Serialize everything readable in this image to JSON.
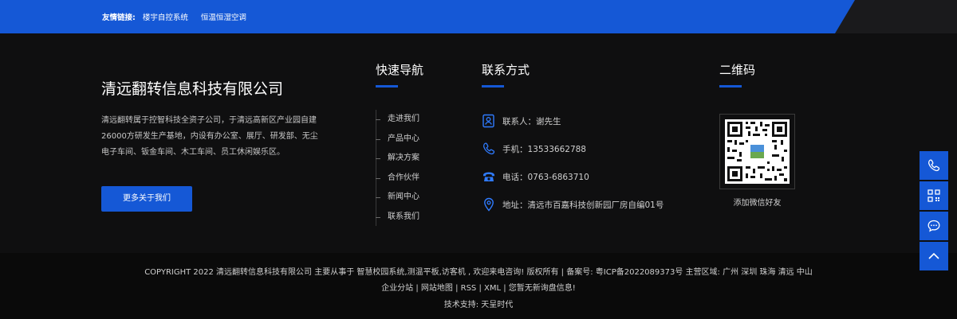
{
  "friend_links": {
    "title": "友情链接:",
    "links": [
      "楼宇自控系统",
      "恒温恒湿空调"
    ]
  },
  "company": {
    "name": "清远翻转信息科技有限公司",
    "description": "清远翻转属于控智科技全资子公司，于清远高新区产业园自建26000方研发生产基地，内设有办公室、展厅、研发部、无尘电子车间、钣金车间、木工车间、员工休闲娱乐区。",
    "more_button": "更多关于我们"
  },
  "quick_nav": {
    "title": "快速导航",
    "items": [
      "走进我们",
      "产品中心",
      "解决方案",
      "合作伙伴",
      "新闻中心",
      "联系我们"
    ]
  },
  "contact": {
    "title": "联系方式",
    "items": [
      {
        "icon": "contact-person-icon",
        "text": "联系人：谢先生"
      },
      {
        "icon": "mobile-phone-icon",
        "text": "手机：13533662788"
      },
      {
        "icon": "telephone-icon",
        "text": "电话：0763-6863710"
      },
      {
        "icon": "location-pin-icon",
        "text": "地址：清远市百嘉科技创新园厂房自编01号"
      }
    ]
  },
  "qrcode": {
    "title": "二维码",
    "caption": "添加微信好友"
  },
  "footer": {
    "line1": "COPYRIGHT 2022 清远翻转信息科技有限公司    主要从事于 智慧校园系统,测温平板,访客机 , 欢迎来电咨询!    版权所有 | 备案号:    粤ICP备2022089373号 主营区域:    广州 深圳 珠海 清远 中山",
    "line2": "企业分站 | 网站地图 | RSS | XML | 您暂无新询盘信息!",
    "line3": "技术支持:    天呈时代"
  },
  "side_bar": {
    "buttons": [
      "phone-icon",
      "qrcode-icon",
      "chat-icon",
      "back-to-top-icon"
    ]
  },
  "colors": {
    "accent": "#1558d6",
    "background": "#0f0f10",
    "footer_bottom": "#0a0a0a"
  }
}
